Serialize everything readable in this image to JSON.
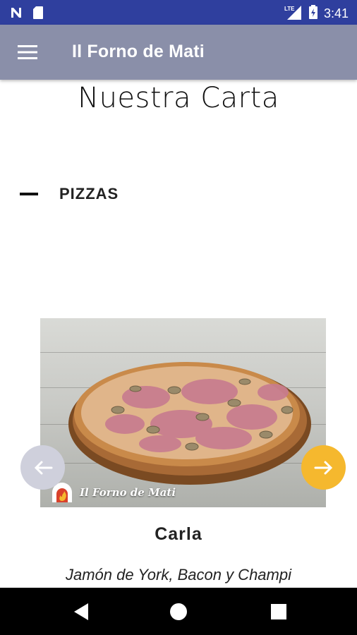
{
  "status_bar": {
    "time": "3:41",
    "network": "LTE"
  },
  "app_bar": {
    "title": "Il Forno de Mati"
  },
  "page": {
    "title": "Nuestra Carta"
  },
  "section": {
    "label": "PIZZAS"
  },
  "carousel": {
    "watermark": "Il Forno de Mati",
    "item": {
      "name": "Carla",
      "description": "Jamón de York, Bacon y Champi"
    }
  },
  "colors": {
    "status_bar": "#2f3f9e",
    "app_bar": "#8a8fa9",
    "next_button": "#f5b82e",
    "prev_button": "#cfd0dc"
  },
  "icons": {
    "status_left": [
      "n-notification-icon",
      "sd-card-icon"
    ],
    "status_right": [
      "lte-signal-icon",
      "battery-charging-icon"
    ],
    "app_bar": "menu-icon",
    "carousel": [
      "arrow-left-icon",
      "arrow-right-icon"
    ],
    "navigation": [
      "back-icon",
      "home-icon",
      "recents-icon"
    ]
  }
}
